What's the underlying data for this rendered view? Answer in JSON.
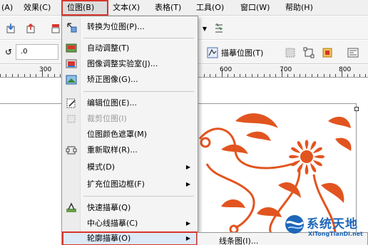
{
  "menubar": {
    "items": [
      {
        "label": "(A)"
      },
      {
        "label": "效果(C)"
      },
      {
        "label": "位图(B)"
      },
      {
        "label": "文本(X)"
      },
      {
        "label": "表格(T)"
      },
      {
        "label": "工具(O)"
      },
      {
        "label": "窗口(W)"
      },
      {
        "label": "帮助(H)"
      }
    ]
  },
  "toolbar": {
    "zoom_value": ".0",
    "trace_button_label": "描摹位图(T)"
  },
  "ruler": {
    "labels": [
      "300",
      "600",
      "700",
      "800"
    ]
  },
  "bitmap_menu": {
    "items": [
      {
        "label": "转换为位图(P)...",
        "icon": "convert-bitmap-icon"
      },
      {
        "label": "自动调整(T)",
        "icon": "auto-adjust-icon"
      },
      {
        "label": "图像调整实验室(J)...",
        "icon": "image-lab-icon"
      },
      {
        "label": "矫正图像(G)...",
        "icon": "straighten-icon"
      },
      {
        "label": "编辑位图(E)...",
        "icon": "edit-bitmap-icon"
      },
      {
        "label": "裁剪位图(I)",
        "icon": "crop-bitmap-icon"
      },
      {
        "label": "位图颜色遮罩(M)",
        "icon": ""
      },
      {
        "label": "重新取样(R)...",
        "icon": "resample-icon"
      },
      {
        "label": "模式(D)",
        "icon": ""
      },
      {
        "label": "扩充位图边框(F)",
        "icon": ""
      },
      {
        "label": "快速描摹(Q)",
        "icon": "quick-trace-icon"
      },
      {
        "label": "中心线描摹(C)",
        "icon": ""
      },
      {
        "label": "轮廓描摹(O)",
        "icon": ""
      }
    ]
  },
  "submenu": {
    "first_item": "线条图(I)..."
  },
  "watermark": {
    "title": "系统天地",
    "subtitle": "XiTongTianDi.net"
  },
  "colors": {
    "highlight_box": "#d9342b",
    "ornament": "#e2541f",
    "watermark": "#1e66b8"
  }
}
